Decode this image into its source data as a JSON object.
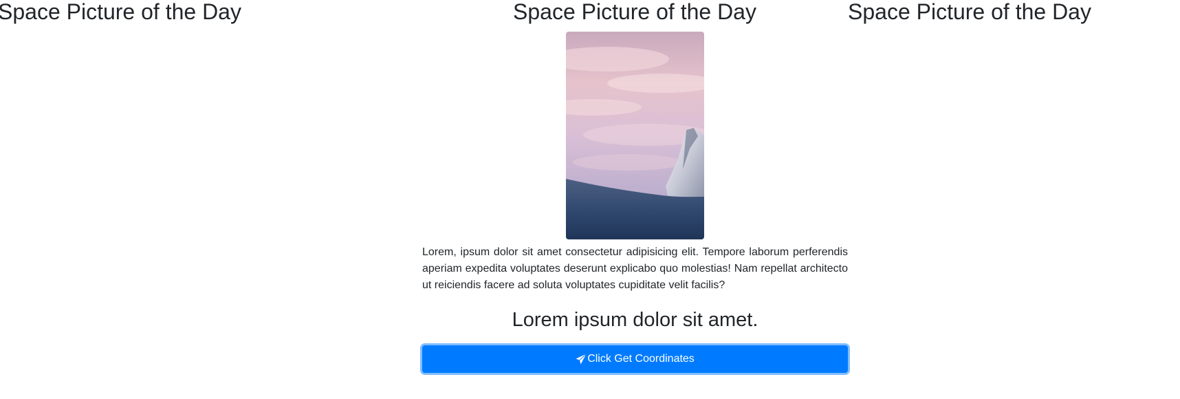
{
  "header": {
    "title_left": "Space Picture of the Day",
    "title_center": "Space Picture of the Day",
    "title_right": "Space Picture of the Day"
  },
  "main": {
    "image_subject": "snowy mountain peak under pink sunset clouds",
    "description": "Lorem, ipsum dolor sit amet consectetur adipisicing elit. Tempore laborum perferendis aperiam expedita voluptates deserunt explicabo quo molestias! Nam repellat architecto ut reiciendis facere ad soluta voluptates cupiditate velit facilis?",
    "subheading": "Lorem ipsum dolor sit amet.",
    "button": {
      "label": "Click Get Coordinates",
      "icon": "paper-plane-icon",
      "color": "#007bff"
    }
  }
}
